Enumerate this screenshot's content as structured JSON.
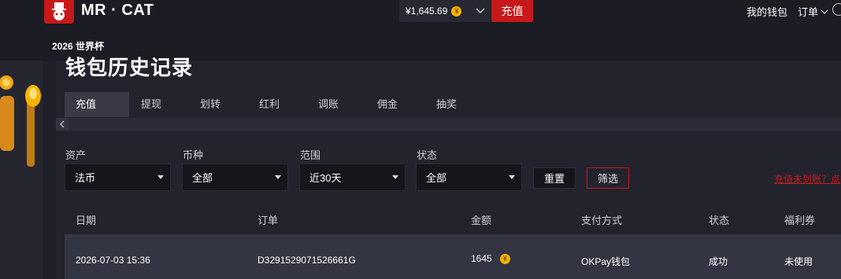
{
  "header": {
    "brand": "MR · CAT",
    "balance": "¥1,645.69",
    "coin_symbol": "¥",
    "deposit_button": "充值",
    "wallet_link": "我的钱包",
    "orders_menu": "订单"
  },
  "subnav": {
    "worldcup_link": "2026 世界杯"
  },
  "page": {
    "title": "钱包历史记录"
  },
  "tabs": [
    {
      "label": "充值",
      "active": true
    },
    {
      "label": "提现"
    },
    {
      "label": "划转"
    },
    {
      "label": "红利"
    },
    {
      "label": "调账"
    },
    {
      "label": "佣金"
    },
    {
      "label": "抽奖"
    }
  ],
  "filters": {
    "asset": {
      "label": "资产",
      "value": "法币"
    },
    "currency": {
      "label": "币种",
      "value": "全部"
    },
    "range": {
      "label": "范围",
      "value": "近30天"
    },
    "status": {
      "label": "状态",
      "value": "全部"
    },
    "reset_button": "重置",
    "filter_button": "筛选",
    "help_link": "充值未到账？点"
  },
  "table": {
    "headers": [
      "日期",
      "订单",
      "金额",
      "支付方式",
      "状态",
      "福利券"
    ],
    "rows": [
      {
        "date": "2026-07-03 15:36",
        "order": "D3291529071526661G",
        "amount": "1645",
        "payment": "OKPay钱包",
        "status": "成功",
        "coupon": "未使用"
      }
    ]
  },
  "colors": {
    "accent": "#c8191a",
    "coin": "#f5b400",
    "background": "#1f2029",
    "row_bg": "#343542"
  }
}
